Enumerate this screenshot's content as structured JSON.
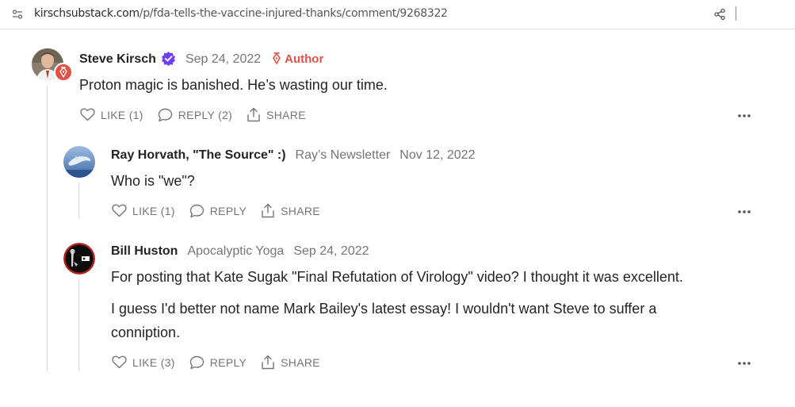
{
  "browser": {
    "url_host": "kirschsubstack.com",
    "url_path": "/p/fda-tells-the-vaccine-injured-thanks/comment/9268322"
  },
  "comments": [
    {
      "author": "Steve Kirsch",
      "date": "Sep 24, 2022",
      "author_tag": "Author",
      "body": [
        "Proton magic is banished. He’s wasting our time."
      ],
      "like": "LIKE (1)",
      "reply": "REPLY (2)",
      "share": "SHARE"
    },
    {
      "author": "Ray Horvath, \"The Source\" :)",
      "publication": "Ray’s Newsletter",
      "date": "Nov 12, 2022",
      "body": [
        "Who is \"we\"?"
      ],
      "like": "LIKE (1)",
      "reply": "REPLY",
      "share": "SHARE"
    },
    {
      "author": "Bill Huston",
      "publication": "Apocalyptic Yoga",
      "date": "Sep 24, 2022",
      "body": [
        "For posting that Kate Sugak \"Final Refutation of Virology\" video? I thought it was excellent.",
        "I guess I'd better not name Mark Bailey's latest essay! I wouldn't want Steve to suffer a",
        "conniption."
      ],
      "like": "LIKE (3)",
      "reply": "REPLY",
      "share": "SHARE"
    }
  ],
  "colors": {
    "accent": "#e25145",
    "verified": "#6e3ff3",
    "muted": "#757575"
  },
  "icons": [
    "site-settings-icon",
    "share-page-icon",
    "verified-icon",
    "author-pen-icon",
    "heart-icon",
    "reply-bubble-icon",
    "share-icon",
    "more-icon"
  ]
}
